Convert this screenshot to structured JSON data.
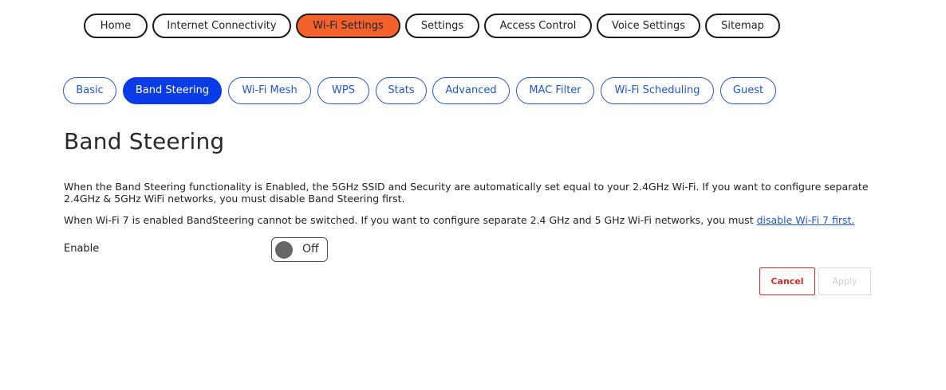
{
  "top_nav": {
    "items": [
      {
        "label": "Home",
        "active": false
      },
      {
        "label": "Internet Connectivity",
        "active": false
      },
      {
        "label": "Wi-Fi Settings",
        "active": true
      },
      {
        "label": "Settings",
        "active": false
      },
      {
        "label": "Access Control",
        "active": false
      },
      {
        "label": "Voice Settings",
        "active": false
      },
      {
        "label": "Sitemap",
        "active": false
      }
    ],
    "active_color": "#f4622b"
  },
  "sub_nav": {
    "tabs": [
      {
        "label": "Basic",
        "active": false
      },
      {
        "label": "Band Steering",
        "active": true
      },
      {
        "label": "Wi-Fi Mesh",
        "active": false
      },
      {
        "label": "WPS",
        "active": false
      },
      {
        "label": "Stats",
        "active": false
      },
      {
        "label": "Advanced",
        "active": false
      },
      {
        "label": "MAC Filter",
        "active": false
      },
      {
        "label": "Wi-Fi Scheduling",
        "active": false
      },
      {
        "label": "Guest",
        "active": false
      }
    ],
    "active_color": "#0a3be8"
  },
  "page": {
    "title": "Band Steering",
    "description_1": "When the Band Steering functionality is Enabled, the 5GHz SSID and Security are automatically set equal to your 2.4GHz Wi-Fi. If you want to configure separate 2.4GHz & 5GHz WiFi networks, you must disable Band Steering first.",
    "description_2_text": "When Wi-Fi 7 is enabled BandSteering cannot be switched. If you want to configure separate 2.4 GHz and 5 GHz Wi-Fi networks, you must ",
    "description_2_link": "disable Wi-Fi 7 first."
  },
  "form": {
    "enable_label": "Enable",
    "toggle_state": "Off"
  },
  "actions": {
    "cancel_label": "Cancel",
    "apply_label": "Apply",
    "apply_disabled": true
  }
}
